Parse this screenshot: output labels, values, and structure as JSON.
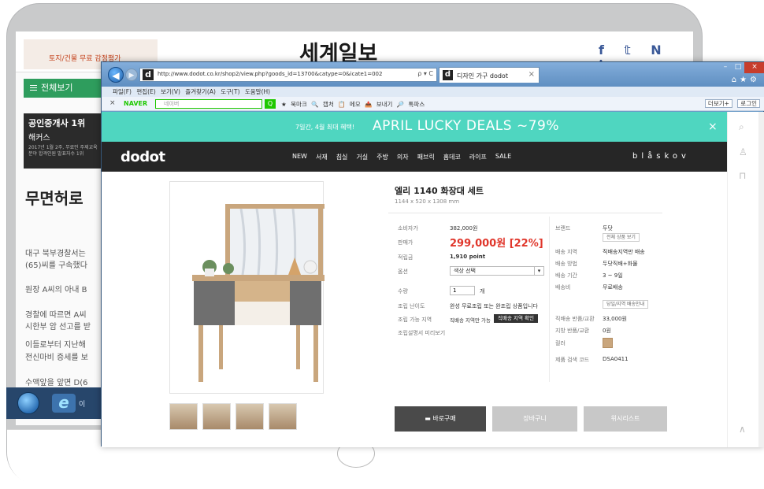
{
  "news": {
    "ad_text": "토지/건물 무료 감정평가",
    "title": "세계일보",
    "social": "f 𝕥 N ℹ",
    "menu_label": "전체보기",
    "side_ad": {
      "line1": "공인중개사 1위",
      "line2": "해커스",
      "line3": "2017년 1월 2주, 무료인 주제교육분야 합격인원 발표자수 1위"
    },
    "headline": "무면허로",
    "lines": [
      "대구 북부경찰서는",
      "(65)씨를 구속했다",
      "원장 A씨의 아내 B",
      "경찰에 따르면 A씨",
      "시한부 암 선고를 받",
      "이들로부터 지난해",
      "전신마비 증세를 보",
      "수액앞을 앞면 D(6"
    ]
  },
  "taskbar": {
    "text": "이"
  },
  "browser": {
    "url": "http://www.dodot.co.kr/shop2/view.php?goods_id=13700&catype=0&icate1=002",
    "addr_controls": "ρ ▾ C",
    "tab_title": "디자인 가구 dodot",
    "menu": "파일(F)  편집(E)  보기(V)  즐겨찾기(A)  도구(T)  도움말(H)",
    "naver": "NAVER",
    "naver_placeholder": "네이버",
    "tools": "★ 북마크  🔍 캡처  📋 메모  📤 보내기  🔎 톡파스",
    "tools_right": [
      "더보기+",
      "로그인"
    ]
  },
  "site": {
    "promo_small": "7일간, 4월 최대 혜택!",
    "promo_big": "APRIL LUCKY DEALS ~79%",
    "logo": "dodot",
    "nav": [
      "NEW",
      "서재",
      "침실",
      "거실",
      "주방",
      "의자",
      "패브릭",
      "홈데코",
      "라이프",
      "SALE"
    ],
    "brand_strip": "blåskov"
  },
  "product": {
    "name": "엘리 1140 화장대 세트",
    "size": "1144 x 520 x 1308 mm",
    "left": [
      {
        "label": "소비자가",
        "value": "382,000원"
      },
      {
        "label": "판매가",
        "value": "299,000원 [22%]"
      },
      {
        "label": "적립금",
        "value": "1,910 point"
      },
      {
        "label": "옵션",
        "value": "색상 선택"
      },
      {
        "label": "수량",
        "value": "1",
        "unit": "개"
      },
      {
        "label": "조립 난이도",
        "value": "완성 무료조립 또는 완조립 상품입니다"
      },
      {
        "label": "조립 가능 지역",
        "value": "직배송 지역만 가능",
        "tag": "직배송 지역 확인"
      },
      {
        "label": "조립설명서 미리보기",
        "value": ""
      }
    ],
    "right": [
      {
        "label": "브랜드",
        "value": "두닷",
        "extra": "전체 상품 보기"
      },
      {
        "label": "배송 지역",
        "value": "직배송지역만 배송"
      },
      {
        "label": "배송 방법",
        "value": "두닷직배+화물"
      },
      {
        "label": "배송 기간",
        "value": "3 ~ 9일"
      },
      {
        "label": "배송비",
        "value": "무료배송",
        "extra": "당일/지역 배송안내"
      },
      {
        "label": "직배송 반품/교환",
        "value": "33,000원"
      },
      {
        "label": "지방 반품/교환",
        "value": "0원"
      },
      {
        "label": "컬러",
        "value": ""
      },
      {
        "label": "제품 검색 코드",
        "value": "DSA0411"
      }
    ],
    "buttons": {
      "buy": "바로구매",
      "cart": "장바구니",
      "wish": "위시리스트"
    }
  },
  "colors": {
    "promo": "#4fd6c0",
    "price": "#e0362b",
    "nav": "#262626"
  }
}
